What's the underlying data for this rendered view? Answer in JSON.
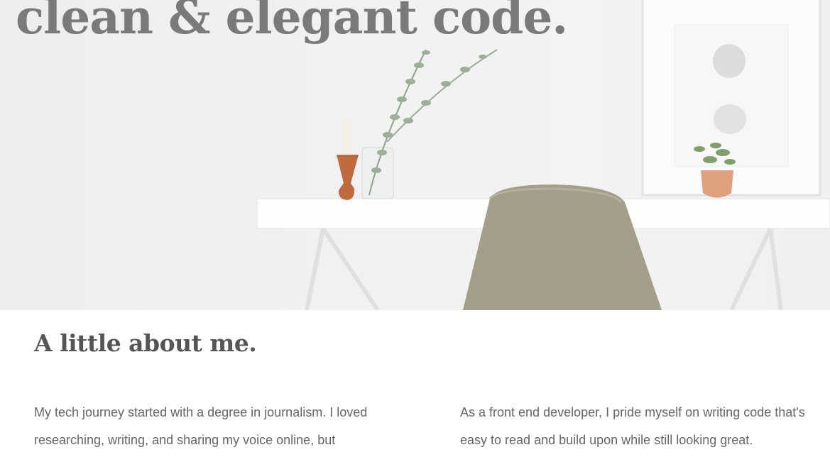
{
  "hero": {
    "title_line": "clean & elegant code."
  },
  "about": {
    "heading": "A little about me.",
    "left_paragraph": "My tech journey started with a degree in journalism. I loved researching, writing, and sharing my voice online, but",
    "right_paragraph": "As a front end developer, I pride myself on writing code that's easy to read and build upon while still looking great."
  },
  "colors": {
    "title": "#7a7a7a",
    "heading": "#555555",
    "body_text": "#666666",
    "page_background": "#ffffff"
  }
}
